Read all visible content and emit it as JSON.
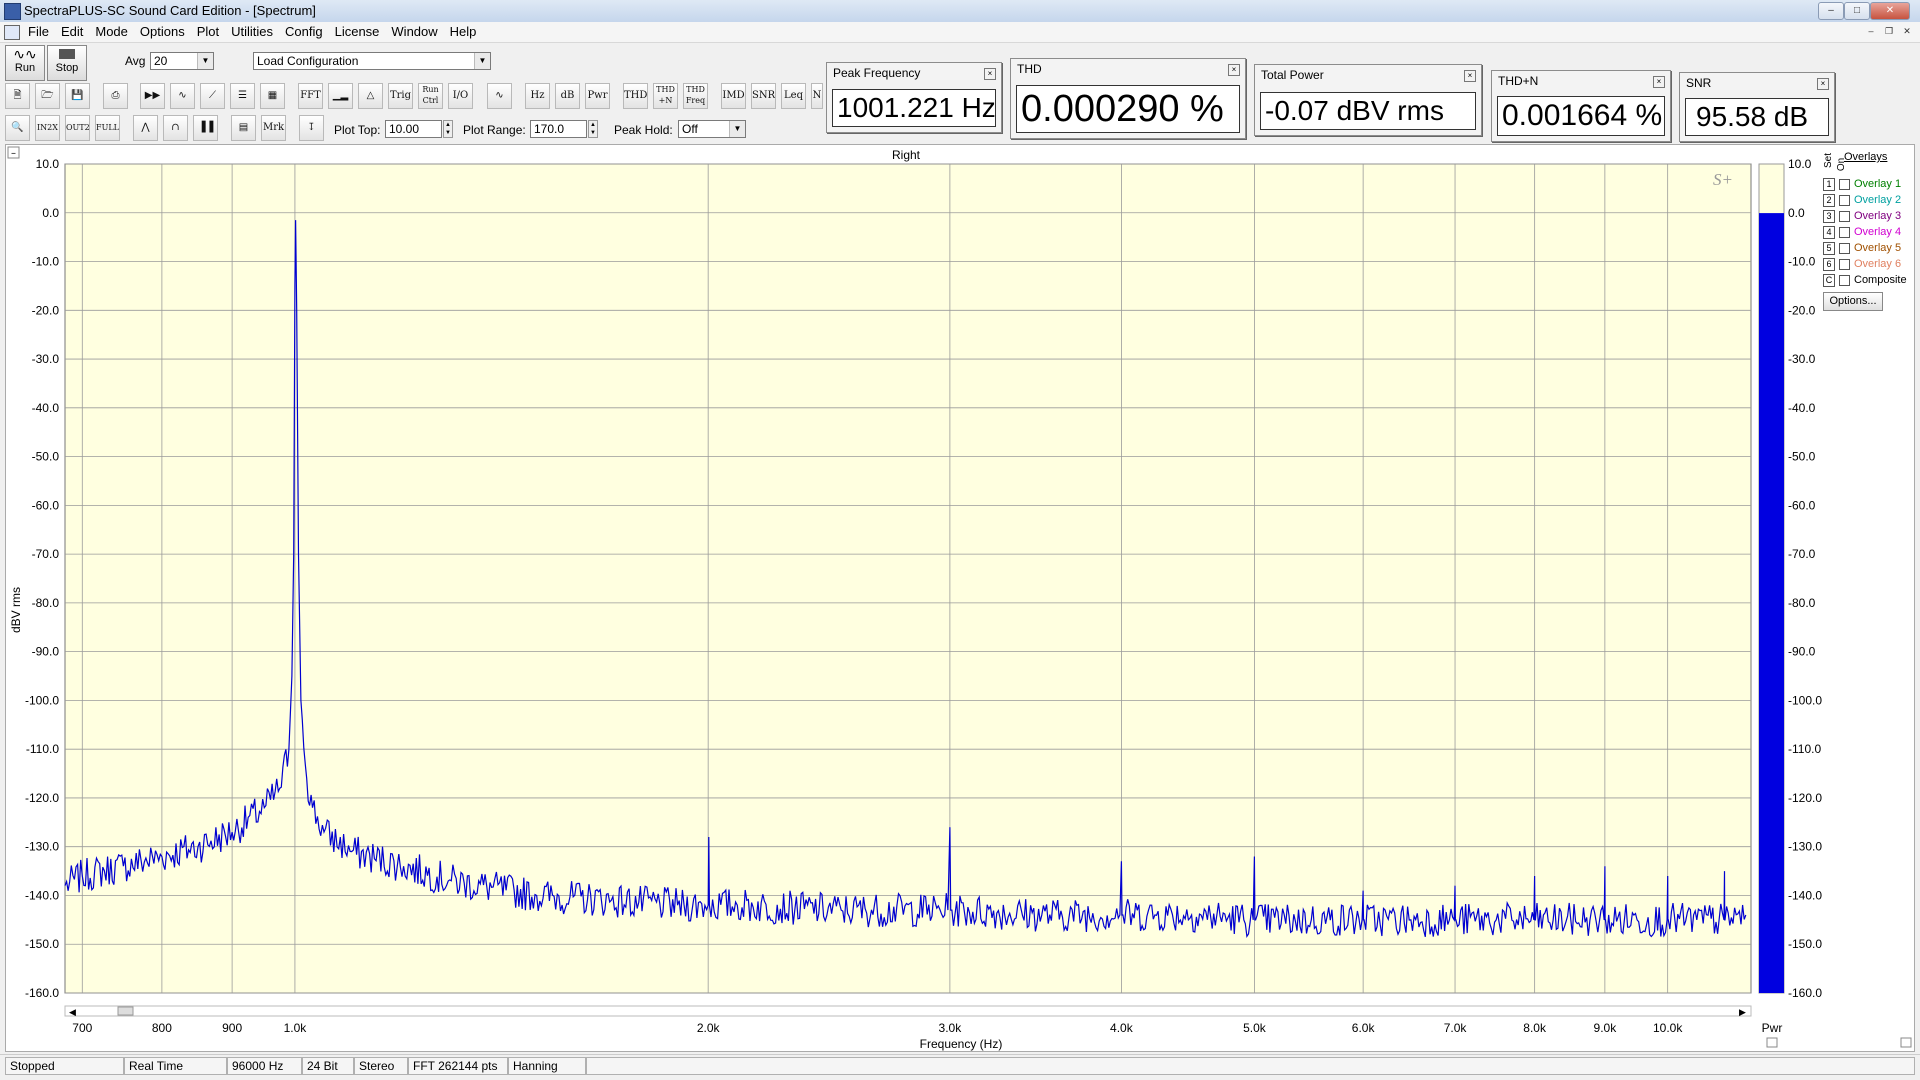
{
  "window": {
    "title": "SpectraPLUS-SC Sound Card Edition - [Spectrum]"
  },
  "menu": [
    "File",
    "Edit",
    "Mode",
    "Options",
    "Plot",
    "Utilities",
    "Config",
    "License",
    "Window",
    "Help"
  ],
  "toolbar": {
    "run_label": "Run",
    "stop_label": "Stop",
    "avg_label": "Avg",
    "avg_value": "20",
    "load_config": "Load Configuration",
    "plot_top_label": "Plot Top:",
    "plot_top_value": "10.00",
    "plot_range_label": "Plot Range:",
    "plot_range_value": "170.0",
    "peak_hold_label": "Peak Hold:",
    "peak_hold_value": "Off",
    "buttons_row1": [
      "FFT",
      "Trig",
      "Run Ctrl",
      "I/O",
      "Hz",
      "dB",
      "Pwr",
      "THD",
      "THD +N",
      "THD Freq",
      "IMD",
      "SNR",
      "Leq"
    ],
    "buttons_row2": [
      "Mrk"
    ]
  },
  "meters": {
    "peak_frequency": {
      "title": "Peak Frequency",
      "value": "1001.221 Hz"
    },
    "thd": {
      "title": "THD",
      "value": "0.000290 %"
    },
    "total_power": {
      "title": "Total Power",
      "value": "-0.07 dBV rms"
    },
    "thd_n": {
      "title": "THD+N",
      "value": "0.001664 %"
    },
    "snr": {
      "title": "SNR",
      "value": "95.58 dB"
    }
  },
  "plot": {
    "channel_title": "Right",
    "logo": "S+",
    "pwr_label": "Pwr",
    "trace_color": "#0000d0",
    "background_color": "#ffffe0"
  },
  "overlays": {
    "title": "Overlays",
    "set_label": "Set",
    "on_label": "On",
    "items": [
      {
        "num": "1",
        "label": "Overlay 1",
        "color": "#008000"
      },
      {
        "num": "2",
        "label": "Overlay 2",
        "color": "#00a0a0"
      },
      {
        "num": "3",
        "label": "Overlay 3",
        "color": "#800080"
      },
      {
        "num": "4",
        "label": "Overlay 4",
        "color": "#d000d0"
      },
      {
        "num": "5",
        "label": "Overlay 5",
        "color": "#a05000"
      },
      {
        "num": "6",
        "label": "Overlay 6",
        "color": "#e08060"
      },
      {
        "num": "C",
        "label": "Composite",
        "color": "#000000"
      }
    ],
    "options_label": "Options..."
  },
  "status": [
    "Stopped",
    "Real Time",
    "96000 Hz",
    "24 Bit",
    "Stereo",
    "FFT 262144 pts",
    "Hanning"
  ],
  "chart_data": {
    "type": "line",
    "title": "Right",
    "xlabel": "Frequency (Hz)",
    "ylabel": "dBV rms",
    "xscale": "log",
    "xlim": [
      680,
      11500
    ],
    "ylim": [
      -160,
      10
    ],
    "xticks": [
      700,
      800,
      900,
      1000,
      2000,
      3000,
      4000,
      5000,
      6000,
      7000,
      8000,
      9000,
      10000
    ],
    "xtick_labels": [
      "700",
      "800",
      "900",
      "1.0k",
      "2.0k",
      "3.0k",
      "4.0k",
      "5.0k",
      "6.0k",
      "7.0k",
      "8.0k",
      "9.0k",
      "10.0k"
    ],
    "yticks": [
      10,
      0,
      -10,
      -20,
      -30,
      -40,
      -50,
      -60,
      -70,
      -80,
      -90,
      -100,
      -110,
      -120,
      -130,
      -140,
      -150,
      -160
    ],
    "ytick_labels": [
      "10.0",
      "0.0",
      "-10.0",
      "-20.0",
      "-30.0",
      "-40.0",
      "-50.0",
      "-60.0",
      "-70.0",
      "-80.0",
      "-90.0",
      "-100.0",
      "-110.0",
      "-120.0",
      "-130.0",
      "-140.0",
      "-150.0",
      "-160.0"
    ],
    "grid": true,
    "series": [
      {
        "x": [
          680,
          700,
          750,
          800,
          850,
          900,
          950,
          975,
          990,
          995,
          998,
          1000,
          1001.2,
          1003,
          1006,
          1010,
          1020,
          1030,
          1050,
          1100,
          1200,
          1300,
          1500,
          1700,
          1900,
          2000,
          2002,
          2004,
          2100,
          2500,
          2990,
          3000,
          3004,
          3010,
          3500,
          3990,
          4000,
          4004,
          4010,
          4500,
          4990,
          5000,
          5004,
          5010,
          5500,
          5990,
          6000,
          6004,
          6010,
          6500,
          6990,
          7000,
          7004,
          7010,
          7500,
          7990,
          8000,
          8004,
          8010,
          8500,
          8990,
          9000,
          9004,
          9010,
          9500,
          9990,
          10000,
          10004,
          10010,
          10500,
          10990,
          11000,
          11004,
          11010,
          11400
        ],
        "y": [
          -138,
          -136,
          -134,
          -132,
          -130,
          -127,
          -122,
          -118,
          -110,
          -95,
          -70,
          -15,
          -1.5,
          -20,
          -70,
          -100,
          -116,
          -122,
          -127,
          -131,
          -134,
          -137,
          -140,
          -141,
          -142,
          -142,
          -128,
          -142,
          -142,
          -143,
          -143,
          -126,
          -143,
          -143,
          -144,
          -144,
          -133,
          -144,
          -144,
          -144,
          -145,
          -132,
          -145,
          -145,
          -145,
          -145,
          -139,
          -145,
          -145,
          -145,
          -145,
          -138,
          -145,
          -145,
          -145,
          -145,
          -136,
          -145,
          -145,
          -145,
          -145,
          -134,
          -145,
          -145,
          -145,
          -145,
          -136,
          -145,
          -145,
          -145,
          -145,
          -135,
          -145,
          -145,
          -144
        ]
      }
    ],
    "bar": {
      "label": "Pwr",
      "value": -0.07
    }
  }
}
